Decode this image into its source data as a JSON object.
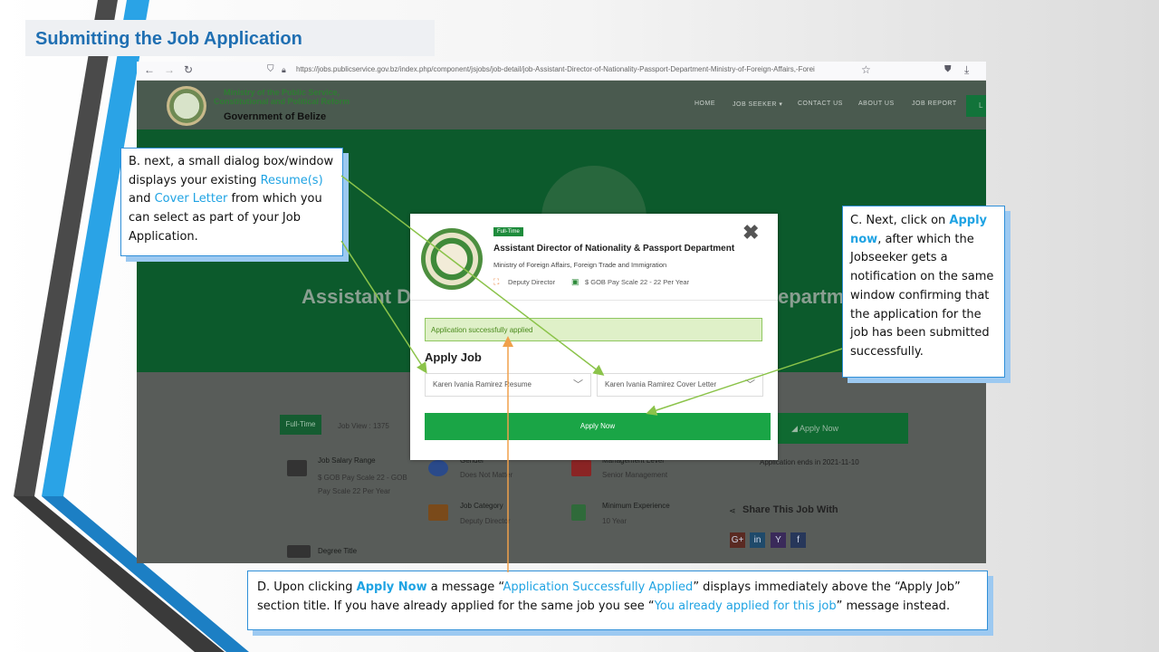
{
  "slide": {
    "title": "Submitting the Job Application"
  },
  "browser": {
    "url": "https://jobs.publicservice.gov.bz/index.php/component/jsjobs/job-detail/job-Assistant-Director-of-Nationality-Passport-Department-Ministry-of-Foreign-Affairs,-Forei",
    "icons": [
      "back-arrow-icon",
      "forward-arrow-icon",
      "reload-icon",
      "shield-icon",
      "lock-icon",
      "star-icon",
      "pocket-icon",
      "download-icon"
    ]
  },
  "site": {
    "org_line1": "Ministry of the Public Service,",
    "org_line2": "Constitutional and Political Reform",
    "org_name": "Government of Belize",
    "nav": [
      "HOME",
      "JOB SEEKER",
      "CONTACT US",
      "ABOUT US",
      "JOB REPORT"
    ],
    "nav_partial": "L",
    "hero_left": "Assistant D",
    "hero_right": "epartm",
    "tab_full_time": "Full-Time",
    "job_view": "Job View : 1375",
    "apply_now_bg": "Apply Now",
    "salary_label": "Job Salary Range",
    "salary_value": "$ GOB Pay Scale 22 - GOB Pay Scale 22 Per Year",
    "gender_label": "Gender",
    "gender_value": "Does Not Matter",
    "mgmt_label": "Management Level",
    "mgmt_value": "Senior Management",
    "ends": "Application ends in 2021-11-10",
    "category_label": "Job Category",
    "category_value": "Deputy Director",
    "experience_label": "Minimum Experience",
    "experience_value": "10 Year",
    "share": "Share This Job With",
    "degree_label": "Degree Title",
    "social": [
      "G+",
      "in",
      "Y",
      "f"
    ]
  },
  "modal": {
    "badge": "Full-Time",
    "title": "Assistant Director of Nationality & Passport Department",
    "ministry": "Ministry of Foreign Affairs, Foreign Trade and Immigration",
    "meta_category": "Deputy Director",
    "meta_salary": "$ GOB Pay Scale 22 - 22 Per Year",
    "success_message": "Application successfully applied",
    "section_title": "Apply Job",
    "resume_select": "Karen Ivania Ramirez Resume",
    "cover_select": "Karen Ivania Ramirez Cover Letter",
    "apply_button": "Apply Now",
    "close": "✖"
  },
  "callouts": {
    "b": {
      "pre": "B. next, a small dialog box/window displays your existing ",
      "resume": "Resume(s)",
      "and": " and ",
      "cover": "Cover Letter",
      "post": " from which you can select as part of your Job Application."
    },
    "c": {
      "pre": "C. Next, click on ",
      "apply": "Apply now",
      "post": ", after which the Jobseeker gets a notification on the same window confirming that the application for the job has been submitted successfully."
    },
    "d": {
      "pre": "D. Upon clicking ",
      "apply": "Apply Now",
      "mid1": " a message “",
      "msg1": "Application Successfully Applied",
      "mid2": "” displays immediately above the “Apply Job” section title. If you have already applied for the same job you see “",
      "msg2": "You already applied for this job",
      "post": "” message instead."
    }
  },
  "colors": {
    "accent_blue": "#1fa3e3",
    "title_blue": "#1f6fb2",
    "apply_green": "#1aa546",
    "success_bg": "#dff0c8",
    "arrow_green": "#8bc34a",
    "arrow_orange": "#f0a04b"
  }
}
